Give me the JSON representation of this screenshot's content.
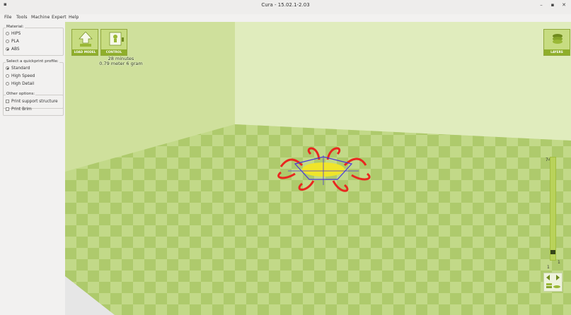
{
  "window": {
    "title": "Cura - 15.02.1-2.03",
    "sys_glyph": "▪",
    "minimize": "–",
    "maximize": "▪",
    "close": "✕"
  },
  "menu": [
    "File",
    "Tools",
    "Machine",
    "Expert",
    "Help"
  ],
  "sidebar": {
    "material": {
      "label": "Material:",
      "options": [
        "HIPS",
        "PLA",
        "ABS"
      ],
      "selected": "ABS"
    },
    "profile": {
      "label": "Select a quickprint profile:",
      "options": [
        "Standard",
        "High Speed",
        "High Detail"
      ],
      "selected": "Standard"
    },
    "other": {
      "label": "Other options:",
      "options": [
        "Print support structure",
        "Print Brim"
      ]
    }
  },
  "toolbar": {
    "load_label": "LOAD MODEL",
    "control_label": "CONTROL",
    "layers_label": "LAYERS",
    "load_icon": "upload-arrow-icon",
    "control_icon": "printer-control-icon",
    "layers_icon": "layers-stack-icon"
  },
  "info": {
    "time": "28 minutes",
    "material_usage": "0.79 meter 6 gram"
  },
  "layers": {
    "max": "74",
    "current": "1",
    "bottom": "1",
    "position_fraction": 0.07
  },
  "view_controls": {
    "toggle_icon": "view-arrows-icon",
    "mode_icon": "view-mode-layers-icon"
  },
  "colors": {
    "bed": "#bfd684",
    "bed_dark": "#a4c360",
    "accent": "#8fae2b",
    "wall": "#cfe0a0",
    "outer_wall": "#e8281f",
    "inner_wall": "#4a39d6",
    "infill": "#f0e52a"
  }
}
